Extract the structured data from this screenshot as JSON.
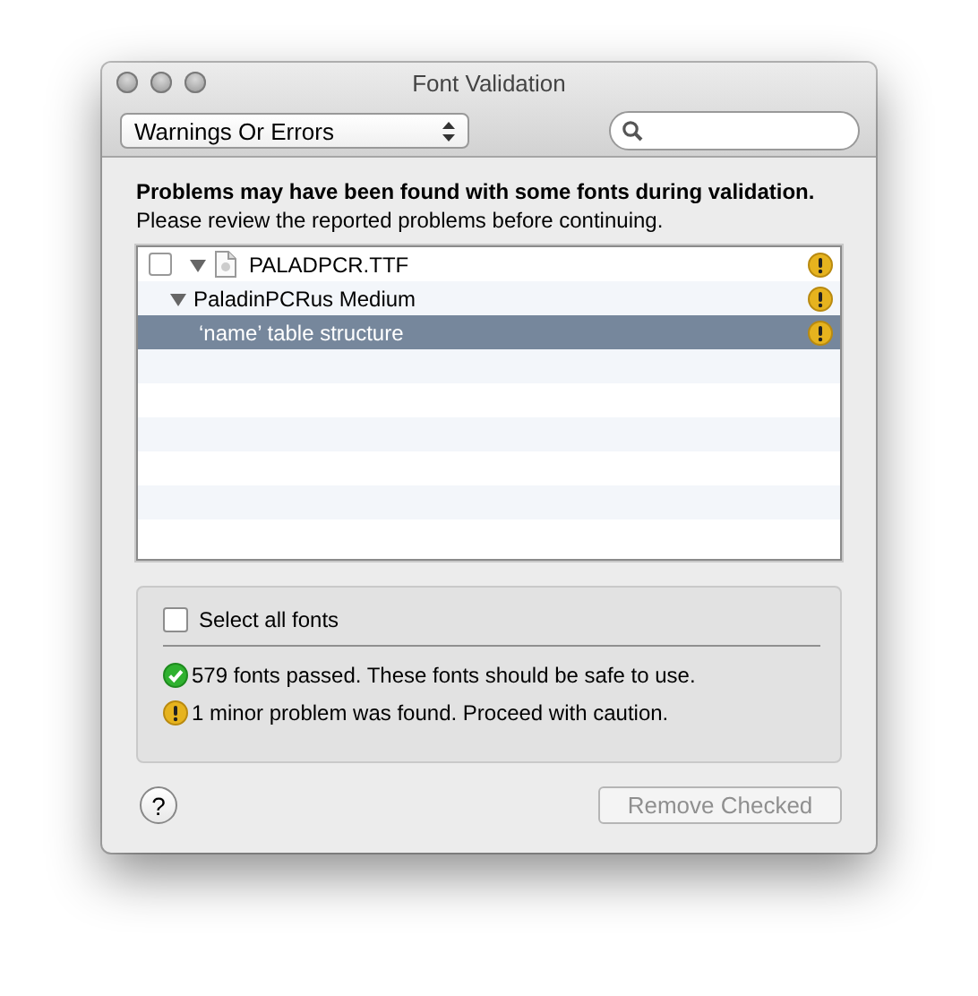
{
  "window": {
    "title": "Font Validation"
  },
  "filter": {
    "value": "Warnings Or Errors"
  },
  "heading": "Problems may have been found with some fonts during validation.",
  "message": "Please review the reported problems before continuing.",
  "tree": [
    {
      "label": "PALADPCR.TTF",
      "kind": "file",
      "warning": true,
      "checked": false,
      "expanded": true,
      "selected": false,
      "children": [
        {
          "label": "PaladinPCRus Medium",
          "kind": "font",
          "warning": true,
          "expanded": true,
          "selected": false,
          "children": [
            {
              "label": "‘name’ table structure",
              "kind": "problem",
              "warning": true,
              "selected": true
            }
          ]
        }
      ]
    }
  ],
  "select_all": {
    "label": "Select all fonts",
    "checked": false
  },
  "results": [
    {
      "kind": "passed",
      "text": "579 fonts passed. These fonts should be safe to use."
    },
    {
      "kind": "warning",
      "text": "1 minor problem was found. Proceed with caution."
    }
  ],
  "help_button": "?",
  "remove_button": {
    "label": "Remove Checked",
    "disabled": true
  }
}
